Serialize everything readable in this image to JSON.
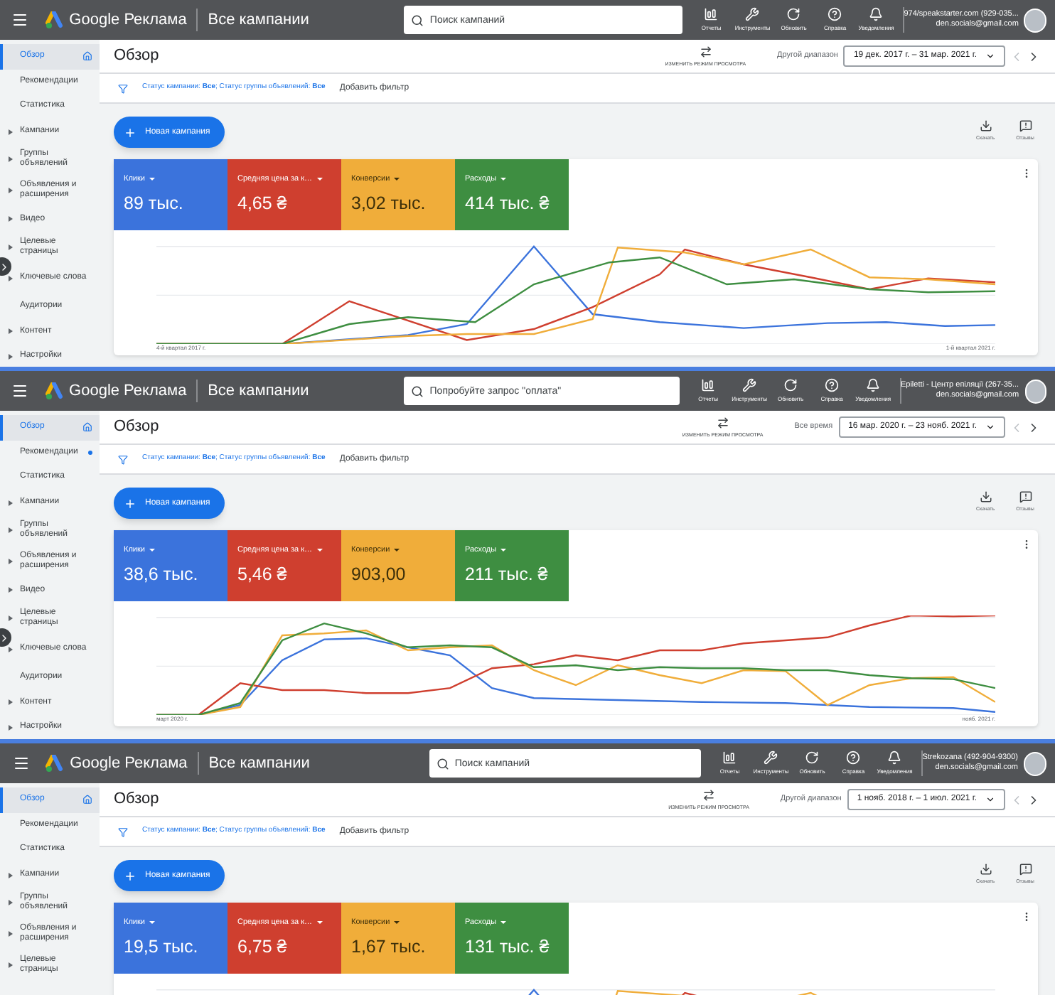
{
  "panels": [
    {
      "header": {
        "brand": "Google Реклама",
        "section": "Все кампании",
        "search_placeholder": "Поиск кампаний",
        "tools": [
          "Отчеты",
          "Инструменты",
          "Обновить",
          "Справка",
          "Уведомления"
        ],
        "account": [
          "974/speakstarter.com (929-035...",
          "den.socials@gmail.com"
        ]
      },
      "sidebar": [
        {
          "label": "Обзор",
          "selected": true,
          "expandable": false,
          "dot": false
        },
        {
          "label": "Рекомендации",
          "selected": false,
          "expandable": false,
          "dot": false
        },
        {
          "label": "Статистика",
          "selected": false,
          "expandable": false,
          "dot": false
        },
        {
          "label": "Кампании",
          "selected": false,
          "expandable": true,
          "dot": false
        },
        {
          "label": "Группы объявлений",
          "selected": false,
          "expandable": true,
          "dot": false
        },
        {
          "label": "Объявления и расширения",
          "selected": false,
          "expandable": true,
          "dot": false
        },
        {
          "label": "Видео",
          "selected": false,
          "expandable": true,
          "dot": false
        },
        {
          "label": "Целевые страницы",
          "selected": false,
          "expandable": true,
          "dot": false
        },
        {
          "label": "Ключевые слова",
          "selected": false,
          "expandable": true,
          "dot": false
        },
        {
          "label": "Аудитории",
          "selected": false,
          "expandable": false,
          "dot": false
        },
        {
          "label": "Контент",
          "selected": false,
          "expandable": true,
          "dot": false
        },
        {
          "label": "Настройки",
          "selected": false,
          "expandable": true,
          "dot": false
        }
      ],
      "page": {
        "title": "Обзор",
        "view_toggle": "ИЗМЕНИТЬ РЕЖИМ ПРОСМОТРА",
        "range_label": "Другой диапазон",
        "date_range": "19 дек. 2017 г. – 31 мар. 2021 г.",
        "filter": "Статус кампании: **Все**; Статус группы объявлений: **Все**",
        "add_filter": "Добавить фильтр",
        "new_campaign": "Новая кампания",
        "actions": [
          "Скачать",
          "Отзывы"
        ],
        "metrics": [
          {
            "label": "Клики",
            "value": "89 тыс.",
            "color": "#3b73dc"
          },
          {
            "label": "Средняя цена за к…",
            "value": "4,65 ₴",
            "color": "#cf3f2f"
          },
          {
            "label": "Конверсии",
            "value": "3,02 тыс.",
            "color": "#f0ad3a"
          },
          {
            "label": "Расходы",
            "value": "414 тыс. ₴",
            "color": "#3e8e41"
          }
        ],
        "x_labels": [
          "4-й квартал 2017 г.",
          "1-й квартал 2021 г."
        ]
      }
    },
    {
      "header": {
        "brand": "Google Реклама",
        "section": "Все кампании",
        "search_placeholder": "Попробуйте запрос \"оплата\"",
        "tools": [
          "Отчеты",
          "Инструменты",
          "Обновить",
          "Справка",
          "Уведомления"
        ],
        "account": [
          "Epiletti - Центр епіляції (267-35...",
          "den.socials@gmail.com"
        ]
      },
      "sidebar": [
        {
          "label": "Обзор",
          "selected": true,
          "expandable": false,
          "dot": false
        },
        {
          "label": "Рекомендации",
          "selected": false,
          "expandable": false,
          "dot": true
        },
        {
          "label": "Статистика",
          "selected": false,
          "expandable": false,
          "dot": false
        },
        {
          "label": "Кампании",
          "selected": false,
          "expandable": true,
          "dot": false
        },
        {
          "label": "Группы объявлений",
          "selected": false,
          "expandable": true,
          "dot": false
        },
        {
          "label": "Объявления и расширения",
          "selected": false,
          "expandable": true,
          "dot": false
        },
        {
          "label": "Видео",
          "selected": false,
          "expandable": true,
          "dot": false
        },
        {
          "label": "Целевые страницы",
          "selected": false,
          "expandable": true,
          "dot": false
        },
        {
          "label": "Ключевые слова",
          "selected": false,
          "expandable": true,
          "dot": false
        },
        {
          "label": "Аудитории",
          "selected": false,
          "expandable": false,
          "dot": false
        },
        {
          "label": "Контент",
          "selected": false,
          "expandable": true,
          "dot": false
        },
        {
          "label": "Настройки",
          "selected": false,
          "expandable": true,
          "dot": false
        }
      ],
      "page": {
        "title": "Обзор",
        "view_toggle": "ИЗМЕНИТЬ РЕЖИМ ПРОСМОТРА",
        "range_label": "Все время",
        "date_range": "16 мар. 2020 г. – 23 нояб. 2021 г.",
        "filter": "Статус кампании: **Все**; Статус группы объявлений: **Все**",
        "add_filter": "Добавить фильтр",
        "new_campaign": "Новая кампания",
        "actions": [
          "Скачать",
          "Отзывы"
        ],
        "metrics": [
          {
            "label": "Клики",
            "value": "38,6 тыс.",
            "color": "#3b73dc"
          },
          {
            "label": "Средняя цена за к…",
            "value": "5,46 ₴",
            "color": "#cf3f2f"
          },
          {
            "label": "Конверсии",
            "value": "903,00",
            "color": "#f0ad3a"
          },
          {
            "label": "Расходы",
            "value": "211 тыс. ₴",
            "color": "#3e8e41"
          }
        ],
        "x_labels": [
          "март 2020 г.",
          "нояб. 2021 г."
        ]
      }
    },
    {
      "header": {
        "brand": "Google Реклама",
        "section": "Все кампании",
        "search_placeholder": "Поиск кампаний",
        "tools": [
          "Отчеты",
          "Инструменты",
          "Обновить",
          "Справка",
          "Уведомления"
        ],
        "account": [
          "Strekozana (492-904-9300)",
          "den.socials@gmail.com"
        ]
      },
      "sidebar": [
        {
          "label": "Обзор",
          "selected": true,
          "expandable": false,
          "dot": false
        },
        {
          "label": "Рекомендации",
          "selected": false,
          "expandable": false,
          "dot": false
        },
        {
          "label": "Статистика",
          "selected": false,
          "expandable": false,
          "dot": false
        },
        {
          "label": "Кампании",
          "selected": false,
          "expandable": true,
          "dot": false
        },
        {
          "label": "Группы объявлений",
          "selected": false,
          "expandable": true,
          "dot": false
        },
        {
          "label": "Объявления и расширения",
          "selected": false,
          "expandable": true,
          "dot": false
        },
        {
          "label": "Целевые страницы",
          "selected": false,
          "expandable": true,
          "dot": false
        }
      ],
      "page": {
        "title": "Обзор",
        "view_toggle": "ИЗМЕНИТЬ РЕЖИМ ПРОСМОТРА",
        "range_label": "Другой диапазон",
        "date_range": "1 нояб. 2018 г. – 1 июл. 2021 г.",
        "filter": "Статус кампании: **Все**; Статус группы объявлений: **Все**",
        "add_filter": "Добавить фильтр",
        "new_campaign": "Новая кампания",
        "actions": [
          "Скачать",
          "Отзывы"
        ],
        "metrics": [
          {
            "label": "Клики",
            "value": "19,5 тыс.",
            "color": "#3b73dc"
          },
          {
            "label": "Средняя цена за к…",
            "value": "6,75 ₴",
            "color": "#cf3f2f"
          },
          {
            "label": "Конверсии",
            "value": "1,67 тыс.",
            "color": "#f0ad3a"
          },
          {
            "label": "Расходы",
            "value": "131 тыс. ₴",
            "color": "#3e8e41"
          }
        ]
      }
    }
  ]
}
